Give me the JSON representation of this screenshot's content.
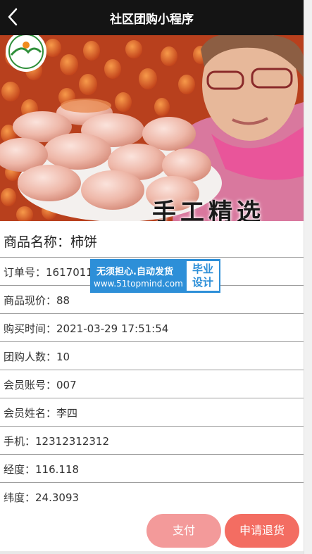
{
  "navbar": {
    "title": "社区团购小程序"
  },
  "banner": {
    "caption": "手工精选"
  },
  "product": {
    "name_label": "商品名称：",
    "name": "柿饼"
  },
  "details": [
    {
      "label": "订单号：",
      "value": "1617011"
    },
    {
      "label": "商品现价：",
      "value": "88"
    },
    {
      "label": "购买时间：",
      "value": "2021-03-29 17:51:54"
    },
    {
      "label": "团购人数：",
      "value": "10"
    },
    {
      "label": "会员账号：",
      "value": "007"
    },
    {
      "label": "会员姓名：",
      "value": "李四"
    },
    {
      "label": "手机：",
      "value": "12312312312"
    },
    {
      "label": "经度：",
      "value": "116.118"
    },
    {
      "label": "纬度：",
      "value": "24.3093"
    }
  ],
  "watermark": {
    "line1": "无须担心.自动发货",
    "line2": "www.51topmind.com",
    "badge_line1": "毕业",
    "badge_line2": "设计"
  },
  "actions": {
    "pay_label": "支付",
    "return_label": "申请退货"
  },
  "colors": {
    "navbar": "#141414",
    "pay_button": "#f39a9a",
    "return_button": "#f36d62",
    "watermark": "#2d8fd8"
  }
}
